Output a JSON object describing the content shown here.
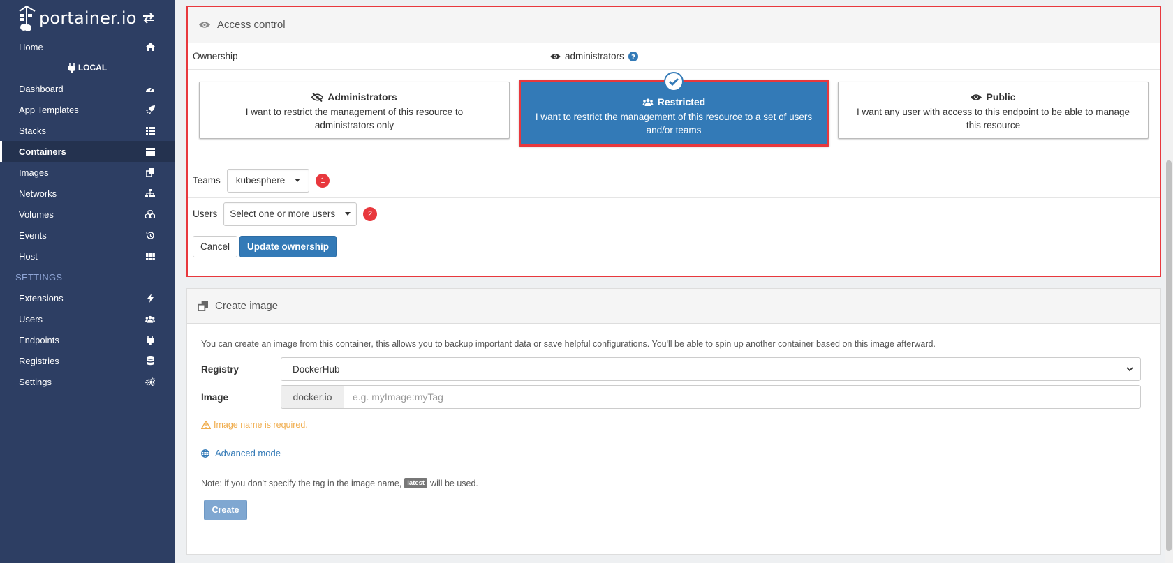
{
  "sidebar": {
    "brand": "portainer.io",
    "endpoint_label": "LOCAL",
    "settings_section": "SETTINGS",
    "items": [
      {
        "label": "Home",
        "icon": "home-icon"
      },
      {
        "label": "Dashboard",
        "icon": "tachometer-icon"
      },
      {
        "label": "App Templates",
        "icon": "rocket-icon"
      },
      {
        "label": "Stacks",
        "icon": "th-list-icon"
      },
      {
        "label": "Containers",
        "icon": "server-icon"
      },
      {
        "label": "Images",
        "icon": "clone-icon"
      },
      {
        "label": "Networks",
        "icon": "sitemap-icon"
      },
      {
        "label": "Volumes",
        "icon": "cubes-icon"
      },
      {
        "label": "Events",
        "icon": "history-icon"
      },
      {
        "label": "Host",
        "icon": "th-icon"
      }
    ],
    "settings_items": [
      {
        "label": "Extensions",
        "icon": "bolt-icon"
      },
      {
        "label": "Users",
        "icon": "users-icon"
      },
      {
        "label": "Endpoints",
        "icon": "plug-icon"
      },
      {
        "label": "Registries",
        "icon": "database-icon"
      },
      {
        "label": "Settings",
        "icon": "cogs-icon"
      }
    ],
    "active_item": "Containers"
  },
  "access_control": {
    "title": "Access control",
    "ownership_label": "Ownership",
    "ownership_value": "administrators",
    "options": [
      {
        "title": "Administrators",
        "description": "I want to restrict the management of this resource to administrators only",
        "icon": "eye-slash-icon"
      },
      {
        "title": "Restricted",
        "description": "I want to restrict the management of this resource to a set of users and/or teams",
        "icon": "users-icon"
      },
      {
        "title": "Public",
        "description": "I want any user with access to this endpoint to be able to manage this resource",
        "icon": "eye-icon"
      }
    ],
    "selected_option": "Restricted",
    "teams_label": "Teams",
    "teams_value": "kubesphere",
    "teams_badge": "1",
    "users_label": "Users",
    "users_placeholder": "Select one or more users",
    "users_badge": "2",
    "cancel_label": "Cancel",
    "update_label": "Update ownership"
  },
  "create_image": {
    "title": "Create image",
    "help_text": "You can create an image from this container, this allows you to backup important data or save helpful configurations. You'll be able to spin up another container based on this image afterward.",
    "registry_label": "Registry",
    "registry_value": "DockerHub",
    "image_label": "Image",
    "image_prefix": "docker.io",
    "image_placeholder": "e.g. myImage:myTag",
    "warning": "Image name is required.",
    "advanced_label": "Advanced mode",
    "note_before": "Note: if you don't specify the tag in the image name,",
    "note_tag": "latest",
    "note_after": "will be used.",
    "create_label": "Create"
  },
  "colors": {
    "sidebar_bg": "#2d3e63",
    "primary": "#337ab7",
    "highlight_border": "#e8383d",
    "warning": "#f0ad4e"
  }
}
